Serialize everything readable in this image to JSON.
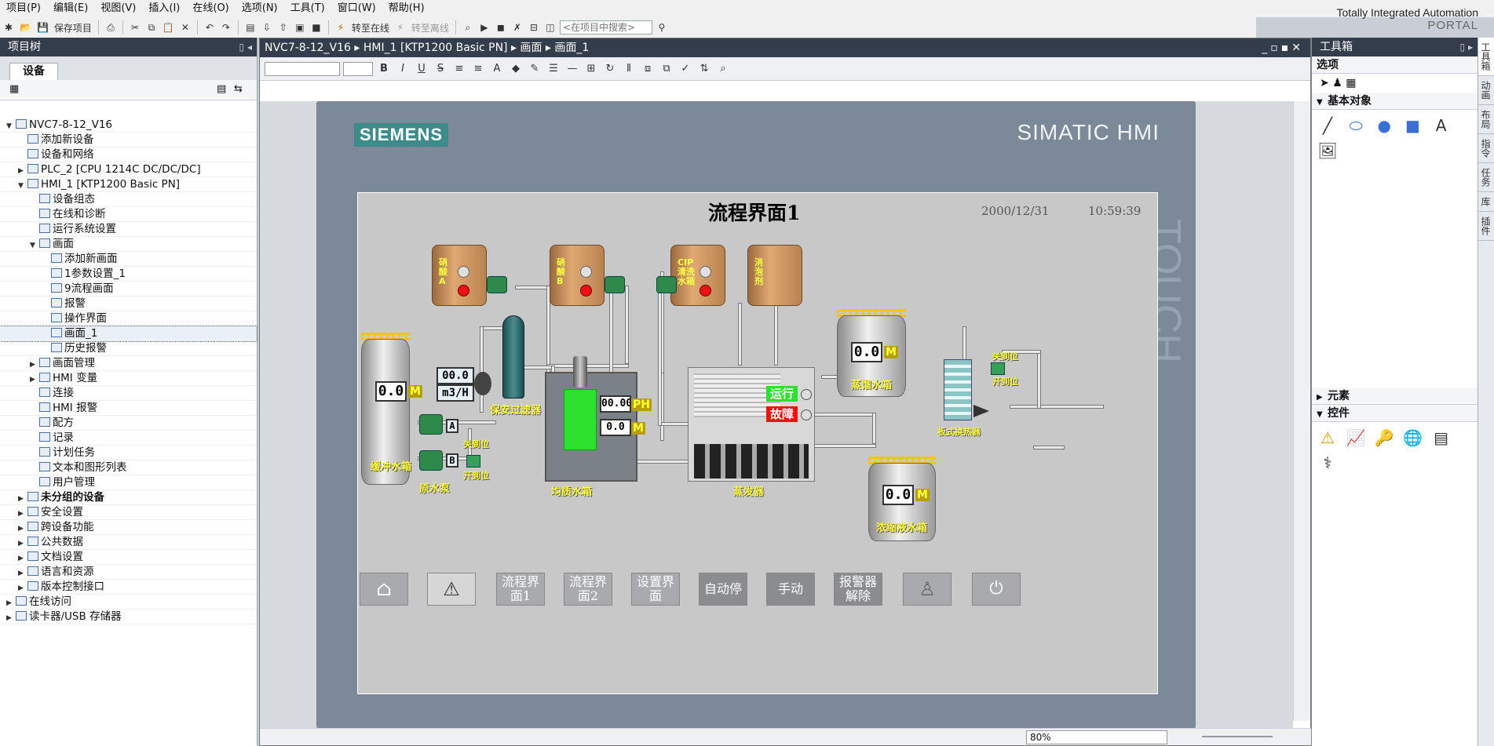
{
  "menus": [
    "项目(P)",
    "编辑(E)",
    "视图(V)",
    "插入(I)",
    "在线(O)",
    "选项(N)",
    "工具(T)",
    "窗口(W)",
    "帮助(H)"
  ],
  "portal": {
    "line1": "Totally Integrated Automation",
    "line2": "PORTAL"
  },
  "toolbar": {
    "save": "保存项目",
    "go_online": "转至在线",
    "go_offline": "转至离线",
    "search_placeholder": "<在项目中搜索>"
  },
  "project_tree": {
    "title": "项目树",
    "tab": "设备",
    "nodes": [
      {
        "label": "NVC7-8-12_V16",
        "arrow": "▼",
        "indent": 0
      },
      {
        "label": "添加新设备",
        "arrow": "",
        "indent": 1
      },
      {
        "label": "设备和网络",
        "arrow": "",
        "indent": 1
      },
      {
        "label": "PLC_2 [CPU 1214C DC/DC/DC]",
        "arrow": "▶",
        "indent": 1
      },
      {
        "label": "HMI_1 [KTP1200 Basic PN]",
        "arrow": "▼",
        "indent": 1
      },
      {
        "label": "设备组态",
        "arrow": "",
        "indent": 2
      },
      {
        "label": "在线和诊断",
        "arrow": "",
        "indent": 2
      },
      {
        "label": "运行系统设置",
        "arrow": "",
        "indent": 2
      },
      {
        "label": "画面",
        "arrow": "▼",
        "indent": 2
      },
      {
        "label": "添加新画面",
        "arrow": "",
        "indent": 3
      },
      {
        "label": "1参数设置_1",
        "arrow": "",
        "indent": 3
      },
      {
        "label": "9流程画面",
        "arrow": "",
        "indent": 3
      },
      {
        "label": "报警",
        "arrow": "",
        "indent": 3
      },
      {
        "label": "操作界面",
        "arrow": "",
        "indent": 3
      },
      {
        "label": "画面_1",
        "arrow": "",
        "indent": 3,
        "selected": true
      },
      {
        "label": "历史报警",
        "arrow": "",
        "indent": 3
      },
      {
        "label": "画面管理",
        "arrow": "▶",
        "indent": 2
      },
      {
        "label": "HMI 变量",
        "arrow": "▶",
        "indent": 2
      },
      {
        "label": "连接",
        "arrow": "",
        "indent": 2
      },
      {
        "label": "HMI 报警",
        "arrow": "",
        "indent": 2
      },
      {
        "label": "配方",
        "arrow": "",
        "indent": 2
      },
      {
        "label": "记录",
        "arrow": "",
        "indent": 2
      },
      {
        "label": "计划任务",
        "arrow": "",
        "indent": 2
      },
      {
        "label": "文本和图形列表",
        "arrow": "",
        "indent": 2
      },
      {
        "label": "用户管理",
        "arrow": "",
        "indent": 2
      },
      {
        "label": "未分组的设备",
        "arrow": "▶",
        "indent": 1,
        "bold": true
      },
      {
        "label": "安全设置",
        "arrow": "▶",
        "indent": 1
      },
      {
        "label": "跨设备功能",
        "arrow": "▶",
        "indent": 1
      },
      {
        "label": "公共数据",
        "arrow": "▶",
        "indent": 1
      },
      {
        "label": "文档设置",
        "arrow": "▶",
        "indent": 1
      },
      {
        "label": "语言和资源",
        "arrow": "▶",
        "indent": 1
      },
      {
        "label": "版本控制接口",
        "arrow": "▶",
        "indent": 1
      },
      {
        "label": "在线访问",
        "arrow": "▶",
        "indent": 0
      },
      {
        "label": "读卡器/USB 存储器",
        "arrow": "▶",
        "indent": 0
      }
    ]
  },
  "editor": {
    "breadcrumb": [
      "NVC7-8-12_V16",
      "HMI_1 [KTP1200 Basic PN]",
      "画面",
      "画面_1"
    ],
    "zoom": "80%"
  },
  "device": {
    "brand": "SIEMENS",
    "model": "SIMATIC HMI",
    "touch": "TOUCH"
  },
  "hmi": {
    "title": "流程界面1",
    "date": "2000/12/31",
    "time": "10:59:39",
    "tanks": {
      "a": "硝酸A",
      "b": "硝酸B",
      "cip": "CIP清洗水箱",
      "foam": "消泡剂"
    },
    "buffer_tank": {
      "label": "缓冲水箱",
      "value": "0.0",
      "unit": "M"
    },
    "flow": {
      "value": "00.0",
      "unit": "m3/H"
    },
    "filter_label": "保安过滤器",
    "pump_label": "原水泵",
    "pump_a": "A",
    "pump_b": "B",
    "valve_close": "关到位",
    "valve_open": "开到位",
    "equalize": {
      "label": "均质水箱",
      "ph_value": "00.00",
      "ph_unit": "PH",
      "level_value": "0.0",
      "level_unit": "M"
    },
    "evaporator": {
      "label": "蒸发器",
      "run": "运行",
      "fault": "故障"
    },
    "distilled": {
      "label": "蒸馏水箱",
      "value": "0.0",
      "unit": "M"
    },
    "concentrate": {
      "label": "浓缩液水箱",
      "value": "0.0",
      "unit": "M"
    },
    "heat_exchanger": "板式换热器",
    "hx_close": "关到位",
    "hx_open": "开到位",
    "nav": [
      "",
      "",
      "流程界面1",
      "流程界面2",
      "设置界面",
      "自动停",
      "手动",
      "报警器解除",
      "",
      ""
    ]
  },
  "toolbox": {
    "title": "工具箱",
    "options": "选项",
    "basic_objects": "基本对象",
    "elements": "元素",
    "controls": "控件",
    "side_tabs": [
      "工具箱",
      "动画",
      "布局",
      "指令",
      "任务",
      "库",
      "插件"
    ]
  }
}
